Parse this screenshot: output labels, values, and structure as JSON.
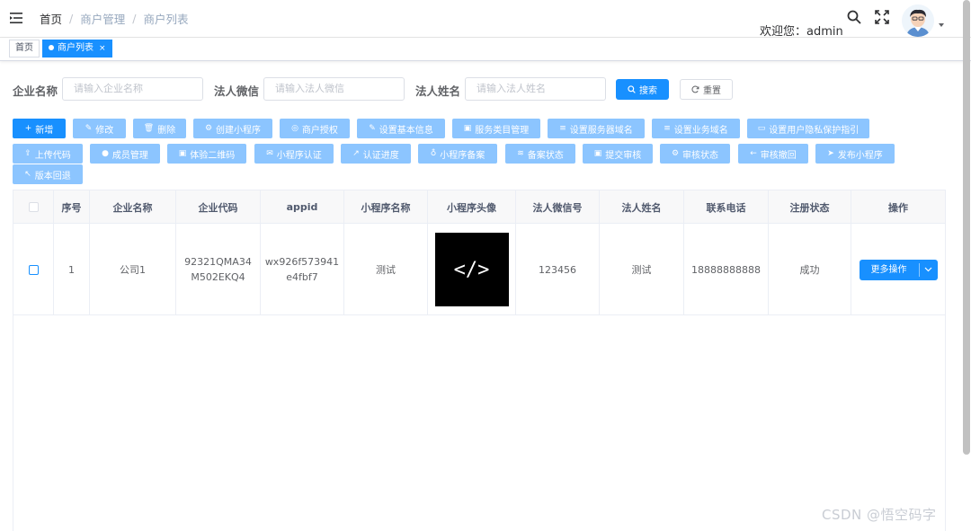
{
  "breadcrumb": {
    "home": "首页",
    "sep": "/",
    "mid": "商户管理",
    "current": "商户列表"
  },
  "header": {
    "welcome": "欢迎您：admin"
  },
  "tags": {
    "home": "首页",
    "active": "商户列表",
    "close": "×"
  },
  "search": {
    "company_label": "企业名称",
    "company_placeholder": "请输入企业名称",
    "wechat_label": "法人微信",
    "wechat_placeholder": "请输入法人微信",
    "name_label": "法人姓名",
    "name_placeholder": "请输入法人姓名",
    "search_btn": "搜索",
    "reset_btn": "重置"
  },
  "toolbar": {
    "row1": [
      {
        "label": "新增",
        "icon": "+"
      },
      {
        "label": "修改",
        "icon": "✎"
      },
      {
        "label": "删除",
        "icon": "🗑"
      },
      {
        "label": "创建小程序",
        "icon": "⚙"
      },
      {
        "label": "商户授权",
        "icon": "◎"
      },
      {
        "label": "设置基本信息",
        "icon": "✎"
      },
      {
        "label": "服务类目管理",
        "icon": "▣"
      },
      {
        "label": "设置服务器域名",
        "icon": "≡"
      },
      {
        "label": "设置业务域名",
        "icon": "≡"
      },
      {
        "label": "设置用户隐私保护指引",
        "icon": "▭"
      }
    ],
    "row2": [
      {
        "label": "上传代码",
        "icon": "⇪"
      },
      {
        "label": "成员管理",
        "icon": "●"
      },
      {
        "label": "体验二维码",
        "icon": "▣"
      },
      {
        "label": "小程序认证",
        "icon": "✉"
      },
      {
        "label": "认证进度",
        "icon": "↗"
      },
      {
        "label": "小程序备案",
        "icon": "♁"
      },
      {
        "label": "备案状态",
        "icon": "≋"
      },
      {
        "label": "提交审核",
        "icon": "▣"
      },
      {
        "label": "审核状态",
        "icon": "⚙"
      },
      {
        "label": "审核撤回",
        "icon": "←"
      },
      {
        "label": "发布小程序",
        "icon": "➤"
      }
    ],
    "row3": [
      {
        "label": "版本回退",
        "icon": "↖"
      }
    ]
  },
  "table": {
    "headers": [
      "",
      "序号",
      "企业名称",
      "企业代码",
      "appid",
      "小程序名称",
      "小程序头像",
      "法人微信号",
      "法人姓名",
      "联系电话",
      "注册状态",
      "操作"
    ],
    "rows": [
      {
        "index": "1",
        "company": "公司1",
        "code_line1": "92321QMA34",
        "code_line2": "M502EKQ4",
        "appid_line1": "wx926f573941",
        "appid_line2": "e4fbf7",
        "app_name": "测试",
        "avatar_glyph": "</>",
        "wechat": "123456",
        "legal_name": "测试",
        "phone": "18888888888",
        "status": "成功",
        "action": "更多操作"
      }
    ]
  },
  "watermark": "CSDN @悟空码字",
  "colors": {
    "primary": "#1890ff",
    "light_primary": "#8cc5ff"
  }
}
